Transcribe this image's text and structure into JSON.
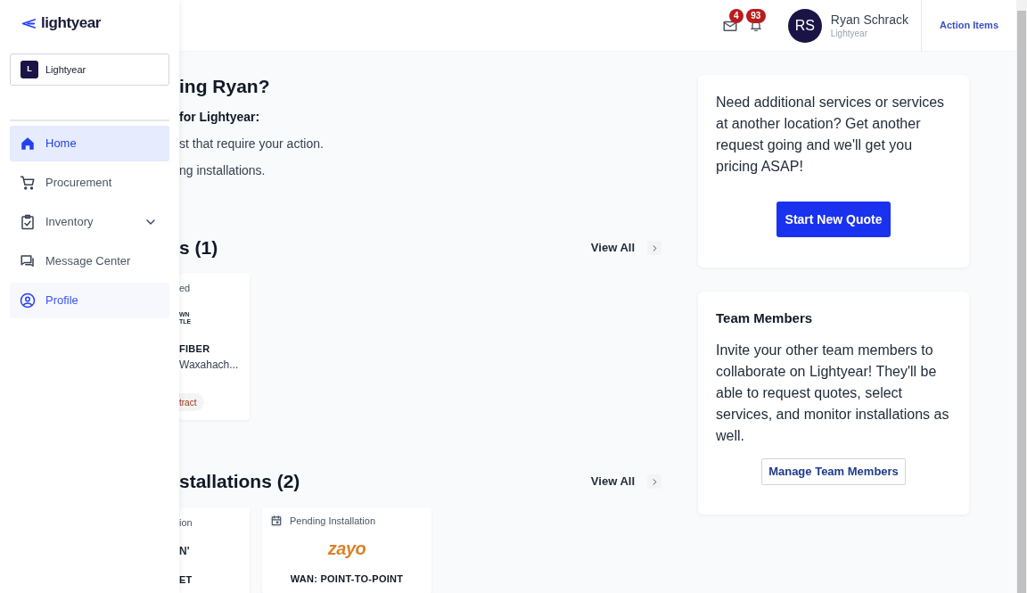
{
  "sidebar": {
    "logo": "lightyear",
    "org_selector": {
      "initial": "L",
      "name": "Lightyear"
    },
    "items": [
      {
        "label": "Home",
        "selected": true,
        "highlighted": false
      },
      {
        "label": "Procurement",
        "selected": false,
        "highlighted": false
      },
      {
        "label": "Inventory",
        "selected": false,
        "highlighted": false,
        "expanded": false
      },
      {
        "label": "Message Center",
        "selected": false,
        "highlighted": false
      },
      {
        "label": "Profile",
        "selected": false,
        "highlighted": true
      }
    ]
  },
  "header": {
    "mail_badge": "4",
    "notification_badge": "93",
    "user": {
      "initials": "RS",
      "name": "Ryan Schrack",
      "org": "Lightyear"
    },
    "action_items": "Action Items"
  },
  "greeting": {
    "title": "ing Ryan?",
    "subtitle": "for Lightyear:",
    "lines": [
      "st that require your action.",
      "ng installations."
    ]
  },
  "sections": [
    {
      "title": "s (1)",
      "view_all": "View All",
      "cards": [
        {
          "kind": "clipped",
          "status": "ed",
          "logo": "WN\nTLE",
          "service": "FIBER",
          "location": "Waxahach...",
          "tag": "tract"
        }
      ]
    },
    {
      "title": "stallations (2)",
      "view_all": "View All",
      "cards": [
        {
          "kind": "clipped",
          "status": "ion",
          "logo": "N'",
          "service": "ET"
        },
        {
          "kind": "full",
          "status": "Pending Installation",
          "logo": "zayo",
          "service": "WAN: POINT-TO-POINT",
          "status_icon": true
        }
      ]
    }
  ],
  "quote_card": {
    "text": "Need additional services or services at another location? Get another request going and we'll get you pricing ASAP!",
    "button": "Start New Quote"
  },
  "team_card": {
    "title": "Team Members",
    "text": "Invite your other team members to collaborate on Lightyear! They'll be able to request quotes, select services, and monitor installations as well.",
    "button": "Manage Team Members"
  }
}
